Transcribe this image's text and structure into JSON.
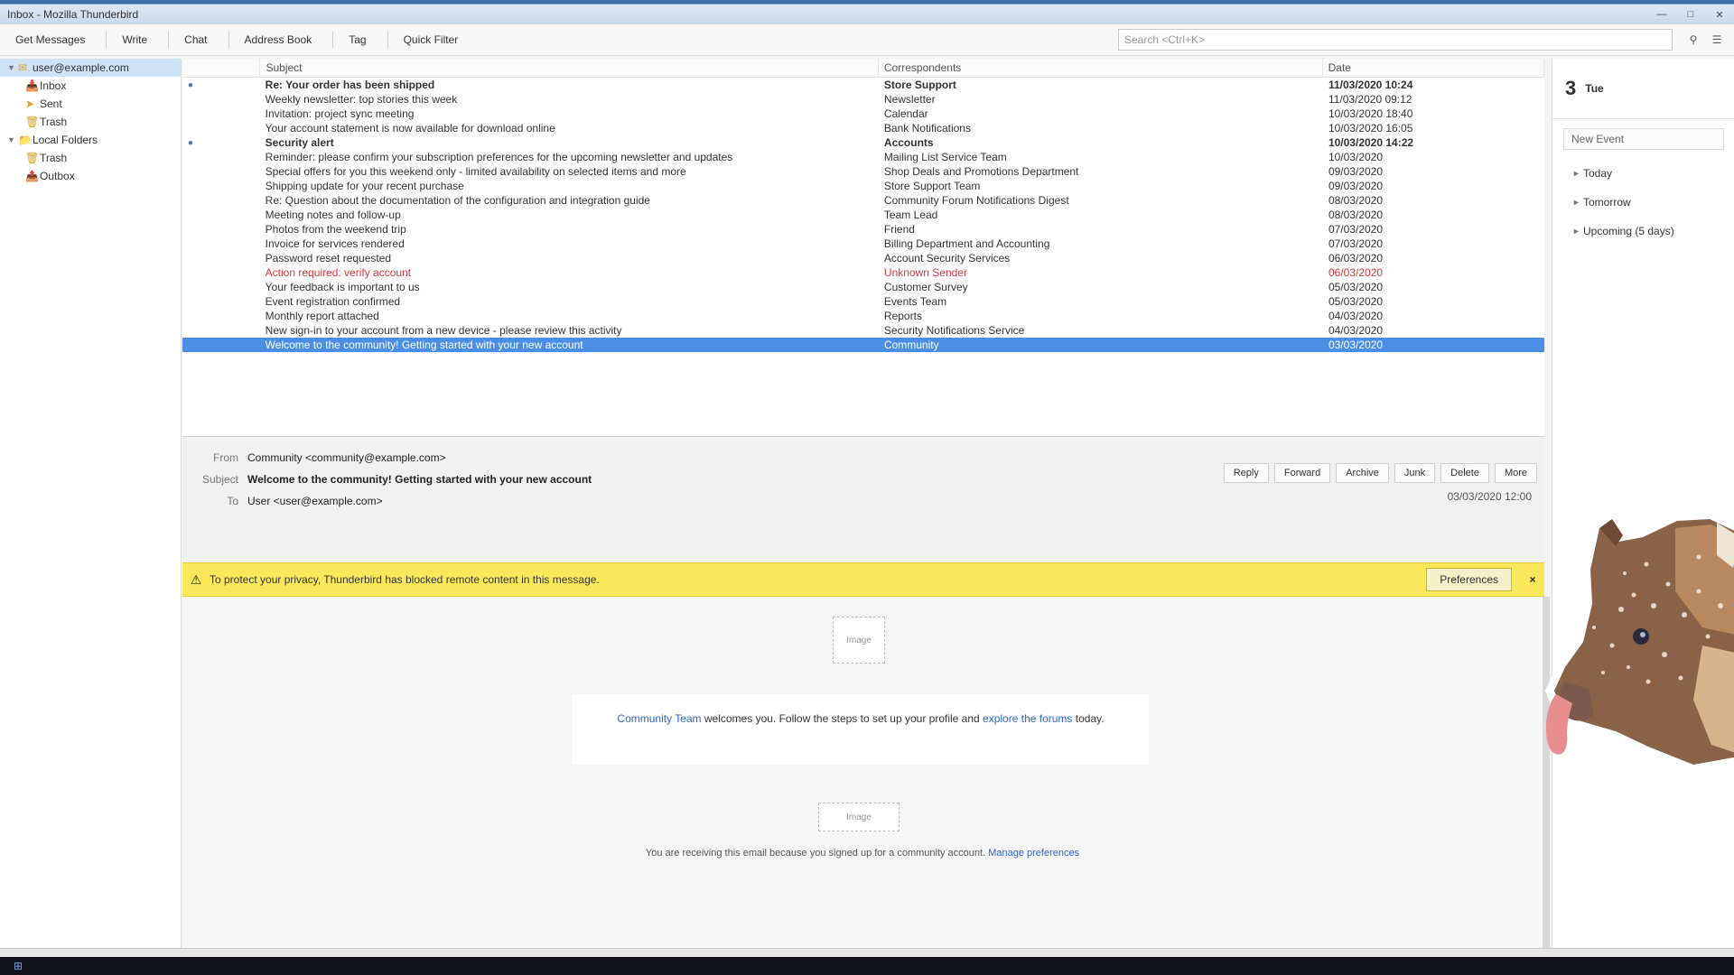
{
  "window": {
    "title": "Inbox - Mozilla Thunderbird"
  },
  "toolbar": {
    "buttons": [
      "Get Messages",
      "Write",
      "Chat",
      "Address Book",
      "Tag",
      "Quick Filter"
    ],
    "search_placeholder": "Search <Ctrl+K>"
  },
  "folders": {
    "account": "user@example.com",
    "items": [
      "Inbox",
      "Sent",
      "Trash"
    ],
    "local": "Local Folders",
    "local_items": [
      "Trash",
      "Outbox"
    ]
  },
  "threads": {
    "columns": [
      "",
      "Subject",
      "Correspondents",
      "Date"
    ],
    "rows": [
      {
        "subject": "Re: Your order has been shipped",
        "from": "Store Support",
        "date": "11/03/2020 10:24",
        "unread": true
      },
      {
        "subject": "Weekly newsletter: top stories this week",
        "from": "Newsletter",
        "date": "11/03/2020 09:12"
      },
      {
        "subject": "Invitation: project sync meeting",
        "from": "Calendar",
        "date": "10/03/2020 18:40"
      },
      {
        "subject": "Your account statement is now available for download online",
        "from": "Bank Notifications",
        "date": "10/03/2020 16:05"
      },
      {
        "subject": "Security alert",
        "from": "Accounts",
        "date": "10/03/2020 14:22",
        "unread": true
      },
      {
        "subject": "Reminder: please confirm your subscription preferences for the upcoming newsletter and updates",
        "from": "Mailing List Service Team",
        "date": "10/03/2020"
      },
      {
        "subject": "Special offers for you this weekend only - limited availability on selected items and more",
        "from": "Shop Deals and Promotions Department",
        "date": "09/03/2020"
      },
      {
        "subject": "Shipping update for your recent purchase",
        "from": "Store Support Team",
        "date": "09/03/2020"
      },
      {
        "subject": "Re: Question about the documentation of the configuration and integration guide",
        "from": "Community Forum Notifications Digest",
        "date": "08/03/2020"
      },
      {
        "subject": "Meeting notes and follow-up",
        "from": "Team Lead",
        "date": "08/03/2020"
      },
      {
        "subject": "Photos from the weekend trip",
        "from": "Friend",
        "date": "07/03/2020"
      },
      {
        "subject": "Invoice for services rendered",
        "from": "Billing Department and Accounting",
        "date": "07/03/2020"
      },
      {
        "subject": "Password reset requested",
        "from": "Account Security Services",
        "date": "06/03/2020"
      },
      {
        "subject": "Action required: verify account",
        "from": "Unknown Sender",
        "date": "06/03/2020",
        "flagged": true
      },
      {
        "subject": "Your feedback is important to us",
        "from": "Customer Survey",
        "date": "05/03/2020"
      },
      {
        "subject": "Event registration confirmed",
        "from": "Events Team",
        "date": "05/03/2020"
      },
      {
        "subject": "Monthly report attached",
        "from": "Reports",
        "date": "04/03/2020"
      },
      {
        "subject": "New sign-in to your account from a new device - please review this activity",
        "from": "Security Notifications Service",
        "date": "04/03/2020"
      },
      {
        "subject": "Welcome to the community! Getting started with your new account",
        "from": "Community",
        "date": "03/03/2020",
        "selected": true
      }
    ]
  },
  "message": {
    "from_label": "From",
    "from": "Community <community@example.com>",
    "subject_label": "Subject",
    "subject": "Welcome to the community! Getting started with your new account",
    "to_label": "To",
    "to": "User <user@example.com>",
    "date": "03/03/2020 12:00",
    "actions": [
      "Reply",
      "Forward",
      "Archive",
      "Junk",
      "Delete",
      "More"
    ]
  },
  "notice": {
    "text": "To protect your privacy, Thunderbird has blocked remote content in this message.",
    "button": "Preferences",
    "close": "×"
  },
  "body": {
    "placeholder_label": "Image",
    "card_link1": "Community Team",
    "card_text": " welcomes you. Follow the steps to set up your profile and ",
    "card_link2": "explore the forums",
    "card_tail": " today.",
    "footer_text": "You are receiving this email because you signed up for a community account. ",
    "footer_link": "Manage preferences"
  },
  "today": {
    "daynum": "3",
    "dayname": "Tue",
    "new_event": "New Event",
    "sections": [
      "Today",
      "Tomorrow",
      "Upcoming (5 days)"
    ]
  },
  "colors": {
    "accent": "#4a8ee6",
    "notice": "#fbe85a",
    "flag": "#d9363e"
  },
  "icons": [
    "search-icon",
    "menu-icon",
    "folder-icon",
    "warning-icon",
    "close-icon"
  ]
}
